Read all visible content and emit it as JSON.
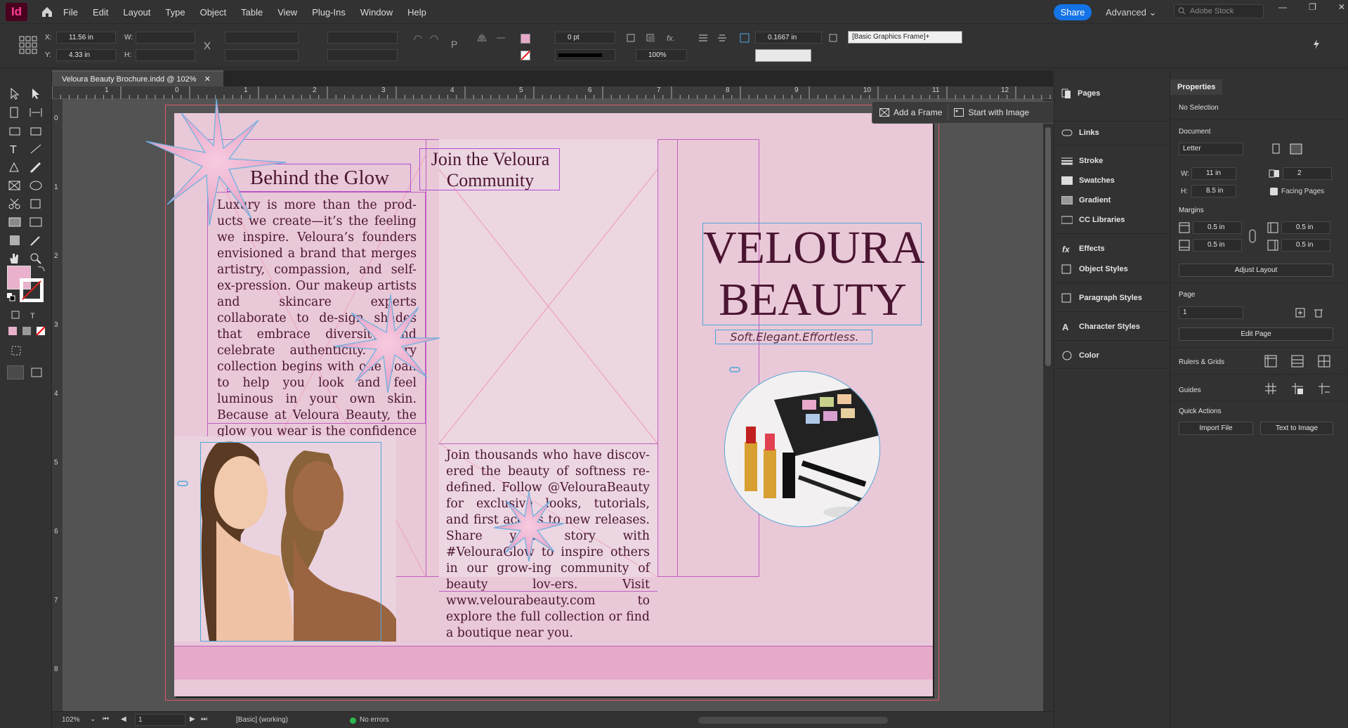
{
  "app": {
    "logo": "Id"
  },
  "menu": [
    "File",
    "Edit",
    "Layout",
    "Type",
    "Object",
    "Table",
    "View",
    "Plug-Ins",
    "Window",
    "Help"
  ],
  "topright": {
    "share": "Share",
    "workspace": "Advanced",
    "stock_placeholder": "Adobe Stock"
  },
  "control": {
    "x_label": "X:",
    "x_value": "11.56 in",
    "y_label": "Y:",
    "y_value": "4.33 in",
    "w_label": "W:",
    "h_label": "H:",
    "stroke_weight": "0 pt",
    "scale": "100%",
    "ref_value": "0.1667 in",
    "style": "[Basic Graphics Frame]+"
  },
  "document": {
    "tab": "Veloura Beauty Brochure.indd @ 102%"
  },
  "ruler": {
    "h": [
      "1",
      "0",
      "1",
      "2",
      "3",
      "4",
      "5",
      "6",
      "7",
      "8",
      "9",
      "10",
      "11",
      "12"
    ],
    "v": [
      "0",
      "1",
      "2",
      "3",
      "4",
      "5",
      "6",
      "7",
      "8"
    ]
  },
  "float": {
    "add_frame": "Add a Frame",
    "start_image": "Start with Image"
  },
  "brochure": {
    "h1": "Behind the Glow",
    "p1": "Luxury is more than the prod-ucts we create—it’s the feeling we inspire. Veloura’s founders envisioned a brand that merges artistry, compassion, and self-ex-pression. Our makeup artists and skincare experts collaborate to de-sign shades that embrace diversity and celebrate authenticity. Every collection begins with one goal: to help you look and feel luminous in your own skin. Because at Veloura Beauty, the glow you wear is the confidence you carry.",
    "h2_line1": "Join the Veloura",
    "h2_line2": "Community",
    "p2": "Join thousands who have discov-ered the beauty of softness re-defined. Follow @VelouraBeauty for exclusive looks, tutorials, and first access to new releases. Share your story with #VelouraGlow to inspire others in our grow-ing community of beauty lov-ers. Visit www.velourabeauty.com to explore the full collection or find a boutique near you.",
    "brand_line1": "VELOURA",
    "brand_line2": "BEAUTY",
    "tagline": "Soft.Elegant.Effortless."
  },
  "status": {
    "zoom": "102%",
    "page": "1",
    "style": "[Basic] (working)",
    "errors": "No errors"
  },
  "panels": [
    "Pages",
    "Links",
    "Stroke",
    "Swatches",
    "Gradient",
    "CC Libraries",
    "Effects",
    "Object Styles",
    "Paragraph Styles",
    "Character Styles",
    "Color"
  ],
  "properties": {
    "title": "Properties",
    "selection": "No Selection",
    "document": "Document",
    "preset": "Letter",
    "w_label": "W:",
    "w": "11 in",
    "h_label": "H:",
    "h": "8.5 in",
    "pages": "2",
    "facing": "Facing Pages",
    "margins": "Margins",
    "m_top": "0.5 in",
    "m_bottom": "0.5 in",
    "m_left": "0.5 in",
    "m_right": "0.5 in",
    "adjust": "Adjust Layout",
    "page": "Page",
    "page_value": "1",
    "edit_page": "Edit Page",
    "rulers": "Rulers & Grids",
    "guides": "Guides",
    "quick": "Quick Actions",
    "import": "Import File",
    "text_image": "Text to Image"
  },
  "colors": {
    "accent": "#1473e6",
    "page": "#e9c8d8",
    "ink": "#4a1530",
    "frame": "#b04fd0",
    "selection": "#4fa6d6"
  }
}
